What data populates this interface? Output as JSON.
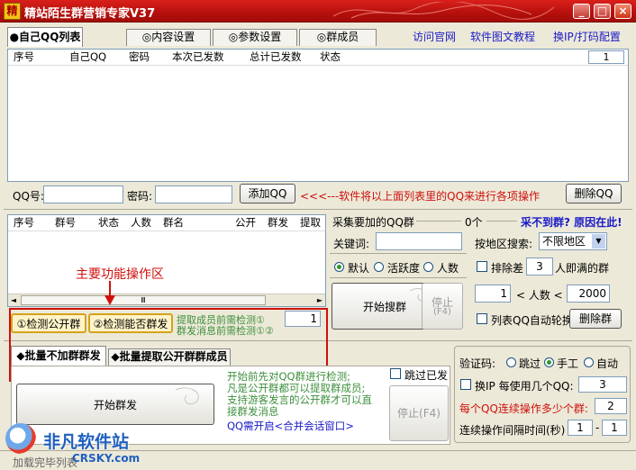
{
  "window": {
    "title": "精站陌生群营销专家V37",
    "logo_glyph": "精",
    "min": "_",
    "max": "□",
    "close": "×"
  },
  "tabs": [
    "●自己QQ列表",
    "◎内容设置",
    "◎参数设置",
    "◎群成员"
  ],
  "top_links": {
    "visit": "访问官网",
    "tutorial": "软件图文教程",
    "ip": "换IP/打码配置"
  },
  "qq_table": {
    "columns": [
      "序号",
      "自己QQ",
      "密码",
      "本次已发数",
      "总计已发数",
      "状态"
    ],
    "page_num": "1"
  },
  "login": {
    "qq_label": "QQ号:",
    "qq_value": "",
    "pwd_label": "密码:",
    "pwd_value": "",
    "add_button": "添加QQ",
    "hint": "<<<---软件将以上面列表里的QQ来进行各项操作",
    "delete_button": "删除QQ"
  },
  "group_table": {
    "columns": [
      "序号",
      "群号",
      "状态",
      "人数",
      "群名",
      "公开",
      "群发",
      "提取"
    ]
  },
  "annotation": "主要功能操作区",
  "check_buttons": {
    "public": "①检测公开群",
    "send": "②检测能否群发",
    "hint1": "提取成员前需检测①",
    "hint2": "群发消息前需检测①②",
    "count": "1"
  },
  "collect": {
    "title": "采集要加的QQ群",
    "count": "0个",
    "link": "采不到群? 原因在此!",
    "keyword_label": "关键词:",
    "keyword_value": "",
    "region_label": "按地区搜索:",
    "region_value": "不限地区",
    "radio_default": "默认",
    "radio_active": "活跃度",
    "radio_people": "人数",
    "exclude_label": "排除差",
    "exclude_value": "3",
    "exclude_suffix": "人即满的群",
    "search_button": "开始搜群",
    "stop_button": "停止",
    "stop_key": "(F4)",
    "min_people": "1",
    "people_label": "<  人数  <",
    "max_people": "2000",
    "rotate_label": "列表QQ自动轮换",
    "delete_button": "删除群"
  },
  "bottom_tabs": [
    "◆批量不加群群发",
    "◆批量提取公开群群成员"
  ],
  "send": {
    "start_button": "开始群发",
    "info": [
      "开始前先对QQ群进行检测;",
      "凡是公开群都可以提取群成员;",
      "支持游客发言的公开群才可以直",
      "接群发消息"
    ],
    "chat_hint": "QQ需开启<合并会话窗口>",
    "skip_label": "跳过已发",
    "stop_button": "停止(F4)"
  },
  "verify": {
    "title": "验证码:",
    "skip": "跳过",
    "manual": "手工",
    "auto": "自动",
    "ip_label": "换IP 每使用几个QQ:",
    "ip_value": "3",
    "ops_label": "每个QQ连续操作多少个群:",
    "ops_value": "2",
    "interval_label": "连续操作间隔时间(秒)",
    "interval_min": "1",
    "interval_dash": "-",
    "interval_max": "1"
  },
  "status_bar": "加载完毕列表",
  "watermark": {
    "brand": "非凡软件站",
    "site": "CRSKY.com"
  },
  "colors": {
    "title_red": "#c4140f",
    "link_blue": "#1a1ac8",
    "note_red": "#d0100c",
    "note_green": "#3d8f3d"
  }
}
